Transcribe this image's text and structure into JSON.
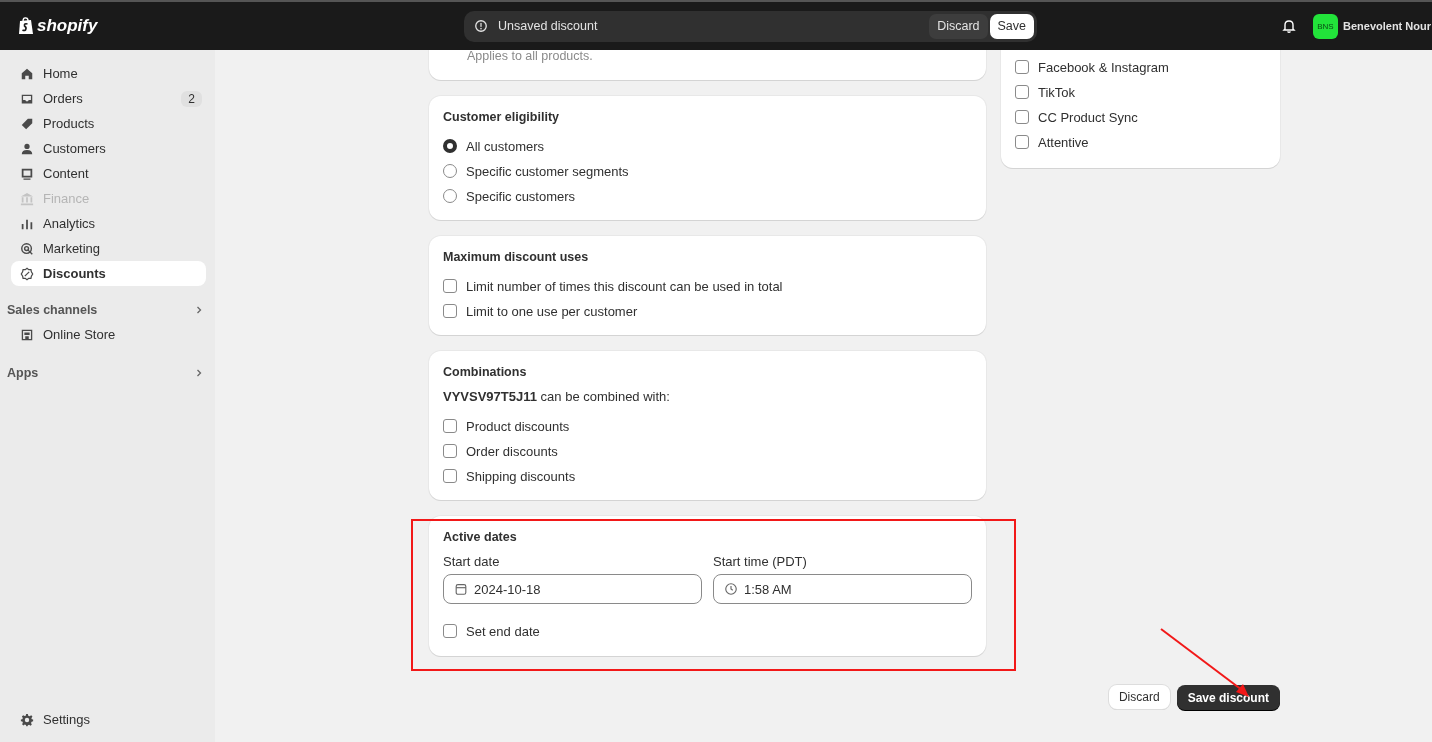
{
  "topbar": {
    "logo": "shopify",
    "save_bar": {
      "message": "Unsaved discount",
      "discard": "Discard",
      "save": "Save"
    },
    "store": {
      "initials": "BNS",
      "name": "Benevolent Nour"
    }
  },
  "sidebar": {
    "items": [
      {
        "label": "Home",
        "selected": false,
        "disabled": false
      },
      {
        "label": "Orders",
        "selected": false,
        "disabled": false,
        "badge": "2"
      },
      {
        "label": "Products",
        "selected": false,
        "disabled": false
      },
      {
        "label": "Customers",
        "selected": false,
        "disabled": false
      },
      {
        "label": "Content",
        "selected": false,
        "disabled": false
      },
      {
        "label": "Finance",
        "selected": false,
        "disabled": true
      },
      {
        "label": "Analytics",
        "selected": false,
        "disabled": false
      },
      {
        "label": "Marketing",
        "selected": false,
        "disabled": false
      },
      {
        "label": "Discounts",
        "selected": true,
        "disabled": false
      }
    ],
    "sales_channels": {
      "title": "Sales channels",
      "items": [
        {
          "label": "Online Store",
          "selected": false
        }
      ]
    },
    "apps": {
      "title": "Apps"
    },
    "settings": "Settings"
  },
  "cards": [
    {
      "kind": "text",
      "text": "Applies to all products."
    },
    {
      "kind": "radios",
      "title": "Customer eligibility",
      "options": [
        {
          "label": "All customers",
          "selected": true
        },
        {
          "label": "Specific customer segments",
          "selected": false
        },
        {
          "label": "Specific customers",
          "selected": false
        }
      ]
    },
    {
      "kind": "checks",
      "title": "Maximum discount uses",
      "options": [
        {
          "label": "Limit number of times this discount can be used in total",
          "checked": false
        },
        {
          "label": "Limit to one use per customer",
          "checked": false
        }
      ]
    },
    {
      "kind": "checks",
      "title": "Combinations",
      "intro": "**VYVSV97T5J11** can be combined with:",
      "options": [
        {
          "label": "Product discounts",
          "checked": false
        },
        {
          "label": "Order discounts",
          "checked": false
        },
        {
          "label": "Shipping discounts",
          "checked": false
        }
      ]
    },
    {
      "kind": "dates",
      "title": "Active dates",
      "highlighted": true,
      "start_date": {
        "label": "Start date",
        "value": "2024-10-18"
      },
      "start_time": {
        "label": "Start time (PDT)",
        "value": "1:58 AM"
      },
      "end_date": {
        "label": "Set end date",
        "checked": false
      }
    }
  ],
  "channels_card": {
    "options": [
      {
        "label": "Facebook & Instagram",
        "checked": false
      },
      {
        "label": "TikTok",
        "checked": false
      },
      {
        "label": "CC Product Sync",
        "checked": false
      },
      {
        "label": "Attentive",
        "checked": false
      }
    ]
  },
  "footer": {
    "discard": "Discard",
    "save": "Save discount",
    "arrow_to_save": true
  }
}
